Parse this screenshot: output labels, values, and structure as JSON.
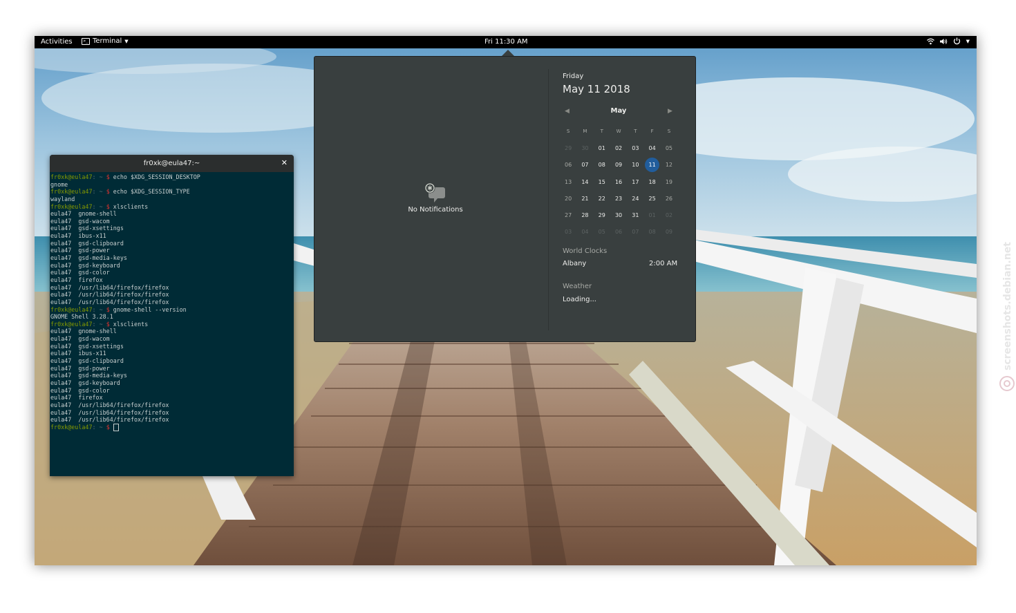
{
  "topbar": {
    "activities_label": "Activities",
    "app_menu_label": "Terminal",
    "clock": "Fri 11:30 AM"
  },
  "notifications": {
    "empty_label": "No Notifications"
  },
  "calendar": {
    "weekday": "Friday",
    "full_date": "May 11 2018",
    "month": "May",
    "weekday_headers": [
      "S",
      "M",
      "T",
      "W",
      "T",
      "F",
      "S"
    ],
    "weeks": [
      [
        "29",
        "30",
        "01",
        "02",
        "03",
        "04",
        "05"
      ],
      [
        "06",
        "07",
        "08",
        "09",
        "10",
        "11",
        "12"
      ],
      [
        "13",
        "14",
        "15",
        "16",
        "17",
        "18",
        "19"
      ],
      [
        "20",
        "21",
        "22",
        "23",
        "24",
        "25",
        "26"
      ],
      [
        "27",
        "28",
        "29",
        "30",
        "31",
        "01",
        "02"
      ],
      [
        "03",
        "04",
        "05",
        "06",
        "07",
        "08",
        "09"
      ]
    ],
    "selected_day": "11"
  },
  "world_clocks": {
    "title": "World Clocks",
    "entries": [
      {
        "city": "Albany",
        "time": "2:00 AM"
      }
    ]
  },
  "weather": {
    "title": "Weather",
    "status": "Loading..."
  },
  "terminal": {
    "title": "fr0xk@eula47:~",
    "prompt_user": "fr0xk@eula47",
    "prompt_path": ": ~ ",
    "prompt_symbol": "$",
    "lines": [
      {
        "type": "cmd",
        "text": "echo $XDG_SESSION_DESKTOP"
      },
      {
        "type": "out",
        "text": "gnome"
      },
      {
        "type": "cmd",
        "text": "echo $XDG_SESSION_TYPE"
      },
      {
        "type": "out",
        "text": "wayland"
      },
      {
        "type": "cmd",
        "text": "xlsclients"
      },
      {
        "type": "out",
        "text": "eula47  gnome-shell"
      },
      {
        "type": "out",
        "text": "eula47  gsd-wacom"
      },
      {
        "type": "out",
        "text": "eula47  gsd-xsettings"
      },
      {
        "type": "out",
        "text": "eula47  ibus-x11"
      },
      {
        "type": "out",
        "text": "eula47  gsd-clipboard"
      },
      {
        "type": "out",
        "text": "eula47  gsd-power"
      },
      {
        "type": "out",
        "text": "eula47  gsd-media-keys"
      },
      {
        "type": "out",
        "text": "eula47  gsd-keyboard"
      },
      {
        "type": "out",
        "text": "eula47  gsd-color"
      },
      {
        "type": "out",
        "text": "eula47  firefox"
      },
      {
        "type": "out",
        "text": "eula47  /usr/lib64/firefox/firefox"
      },
      {
        "type": "out",
        "text": "eula47  /usr/lib64/firefox/firefox"
      },
      {
        "type": "out",
        "text": "eula47  /usr/lib64/firefox/firefox"
      },
      {
        "type": "cmd",
        "text": "gnome-shell --version"
      },
      {
        "type": "out",
        "text": "GNOME Shell 3.28.1"
      },
      {
        "type": "cmd",
        "text": "xlsclients"
      },
      {
        "type": "out",
        "text": "eula47  gnome-shell"
      },
      {
        "type": "out",
        "text": "eula47  gsd-wacom"
      },
      {
        "type": "out",
        "text": "eula47  gsd-xsettings"
      },
      {
        "type": "out",
        "text": "eula47  ibus-x11"
      },
      {
        "type": "out",
        "text": "eula47  gsd-clipboard"
      },
      {
        "type": "out",
        "text": "eula47  gsd-power"
      },
      {
        "type": "out",
        "text": "eula47  gsd-media-keys"
      },
      {
        "type": "out",
        "text": "eula47  gsd-keyboard"
      },
      {
        "type": "out",
        "text": "eula47  gsd-color"
      },
      {
        "type": "out",
        "text": "eula47  firefox"
      },
      {
        "type": "out",
        "text": "eula47  /usr/lib64/firefox/firefox"
      },
      {
        "type": "out",
        "text": "eula47  /usr/lib64/firefox/firefox"
      },
      {
        "type": "out",
        "text": "eula47  /usr/lib64/firefox/firefox"
      },
      {
        "type": "cmd",
        "text": ""
      }
    ]
  },
  "watermark": "screenshots.debian.net",
  "colors": {
    "accent": "#215d9c",
    "popup_bg": "#393f3f",
    "terminal_bg": "#002b36",
    "prompt_green": "#859900",
    "prompt_red": "#dc322f"
  }
}
